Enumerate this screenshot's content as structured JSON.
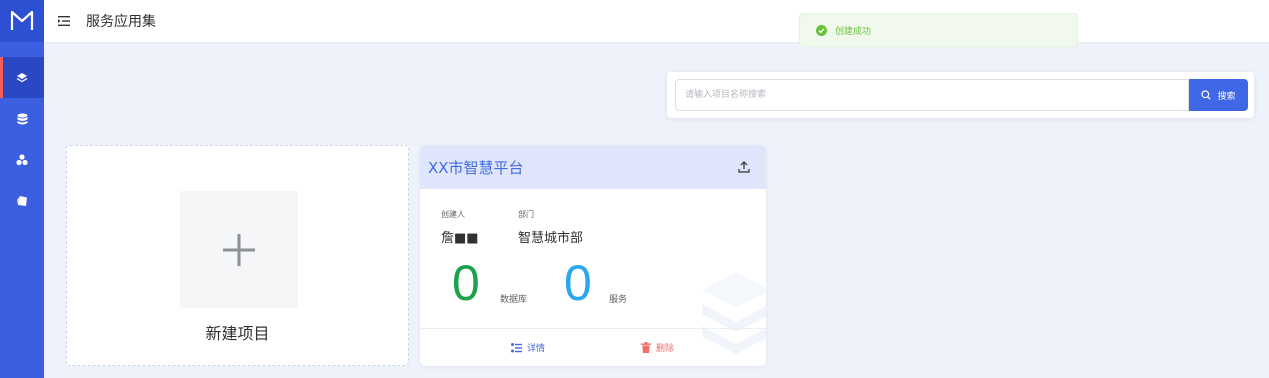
{
  "header": {
    "title": "服务应用集"
  },
  "toast": {
    "message": "创建成功"
  },
  "search": {
    "placeholder": "请输入项目名称搜索",
    "button_label": "搜索"
  },
  "new_project": {
    "label": "新建项目"
  },
  "project": {
    "name": "XX市智慧平台",
    "creator_label": "创建人",
    "creator_value": "詹■■",
    "dept_label": "部门",
    "dept_value": "智慧城市部",
    "db_count": "0",
    "db_label": "数据库",
    "service_count": "0",
    "service_label": "服务",
    "detail_label": "详情",
    "delete_label": "删除"
  },
  "colors": {
    "sidebar": "#3b5fe0",
    "accent": "#4169e1",
    "success": "#67c23a",
    "green_num": "#1aa34a",
    "blue_num": "#2aa8ef",
    "danger": "#f56c6c"
  }
}
